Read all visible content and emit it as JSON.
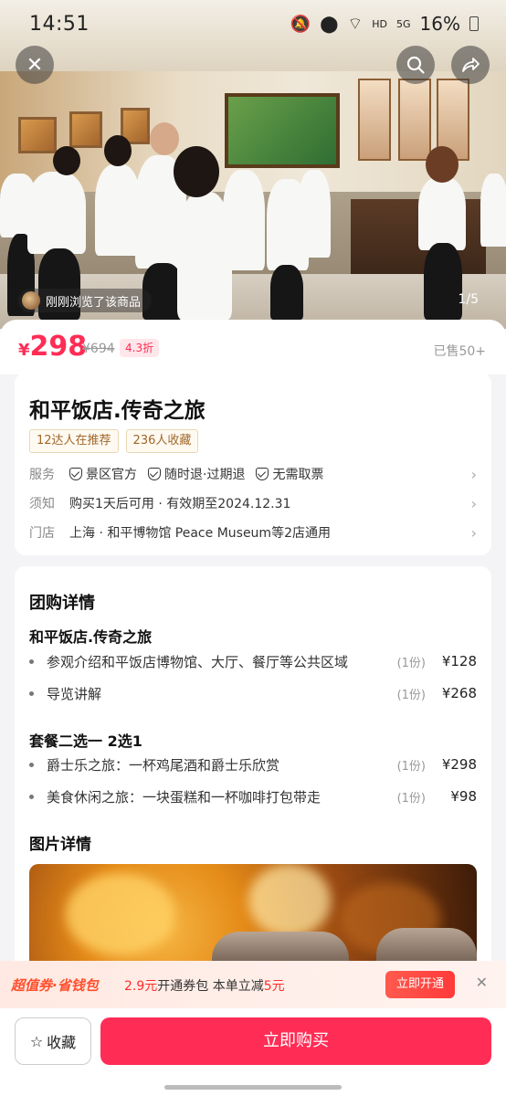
{
  "status_bar": {
    "time": "14:51",
    "battery": "16%",
    "network": "HD",
    "signal": "5G"
  },
  "hero": {
    "browse_text": "刚刚浏览了该商品",
    "pager": "1/5"
  },
  "price": {
    "currency": "¥",
    "current": "298",
    "original": "¥694",
    "discount": "4.3折",
    "sold": "已售50+"
  },
  "product": {
    "title": "和平饭店.传奇之旅",
    "tags": [
      "12达人在推荐",
      "236人收藏"
    ],
    "service_label": "服务",
    "services": [
      "景区官方",
      "随时退·过期退",
      "无需取票"
    ],
    "notice_label": "须知",
    "notice": "购买1天后可用 · 有效期至2024.12.31",
    "store_label": "门店",
    "store": "上海 · 和平博物馆 Peace Museum等2店通用"
  },
  "details": {
    "heading": "团购详情",
    "group1_title": "和平饭店.传奇之旅",
    "group1_items": [
      {
        "name": "参观介绍和平饭店博物馆、大厅、餐厅等公共区域",
        "qty": "(1份)",
        "price": "¥128"
      },
      {
        "name": "导览讲解",
        "qty": "(1份)",
        "price": "¥268"
      }
    ],
    "group2_title": "套餐二选一 2选1",
    "group2_items": [
      {
        "name": "爵士乐之旅：一杯鸡尾酒和爵士乐欣赏",
        "qty": "(1份)",
        "price": "¥298"
      },
      {
        "name": "美食休闲之旅：一块蛋糕和一杯咖啡打包带走",
        "qty": "(1份)",
        "price": "¥98"
      }
    ],
    "pictures_heading": "图片详情"
  },
  "promo": {
    "logo": "超值券·省钱包",
    "text_amount": "2.9元",
    "text_mid": "开通券包 本单立减",
    "text_save": "5元",
    "button": "立即开通"
  },
  "bottom": {
    "favorite": "收藏",
    "buy": "立即购买"
  },
  "colors": {
    "accent": "#ff2d55",
    "tag_text": "#a0672a"
  }
}
